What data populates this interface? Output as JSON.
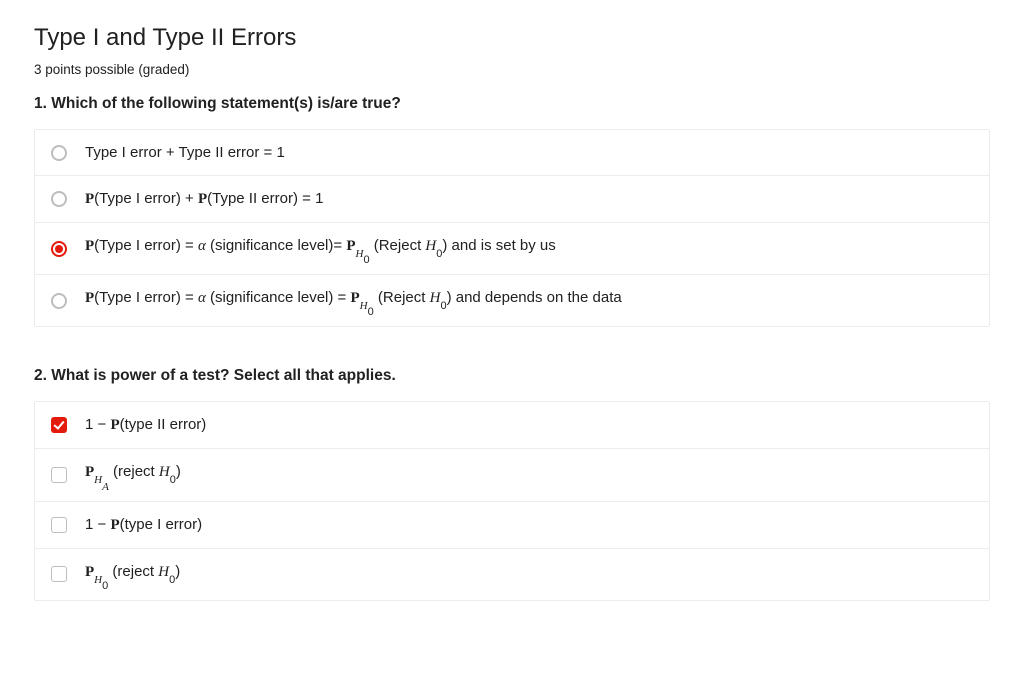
{
  "title": "Type I and Type II Errors",
  "subtitle": "3 points possible (graded)",
  "q1": {
    "prompt": "1. Which of the following statement(s) is/are true?",
    "options": [
      {
        "selected": false,
        "parts": [
          "Type I error + Type II error = 1"
        ]
      },
      {
        "selected": false,
        "parts": [
          "<b>P</b>(Type I error) + <b>P</b>(Type II error) = 1"
        ]
      },
      {
        "selected": true,
        "parts": [
          "<b>P</b>(Type I error) = <i>α</i> (significance level)= <b>P</b>",
          "<sub><i>H</i><sub>0</sub></sub>",
          " (Reject <i>H</i><sub>0</sub>) and is set by us"
        ]
      },
      {
        "selected": false,
        "parts": [
          "<b>P</b>(Type I error) = <i>α</i> (significance level) = <b>P</b>",
          "<sub><i>H</i><sub>0</sub></sub>",
          " (Reject <i>H</i><sub>0</sub>) and depends on the data"
        ]
      }
    ]
  },
  "q2": {
    "prompt": "2. What is power of a test? Select all that applies.",
    "options": [
      {
        "selected": true,
        "parts": [
          "1 − <b>P</b>(type II error)"
        ]
      },
      {
        "selected": false,
        "parts": [
          "<b>P</b>",
          "<sub><i>H</i><sub><i>A</i></sub></sub>",
          " (reject <i>H</i><sub>0</sub>)"
        ]
      },
      {
        "selected": false,
        "parts": [
          "1 − <b>P</b>(type I error)"
        ]
      },
      {
        "selected": false,
        "parts": [
          "<b>P</b>",
          "<sub><i>H</i><sub>0</sub></sub>",
          " (reject <i>H</i><sub>0</sub>)"
        ]
      }
    ]
  }
}
